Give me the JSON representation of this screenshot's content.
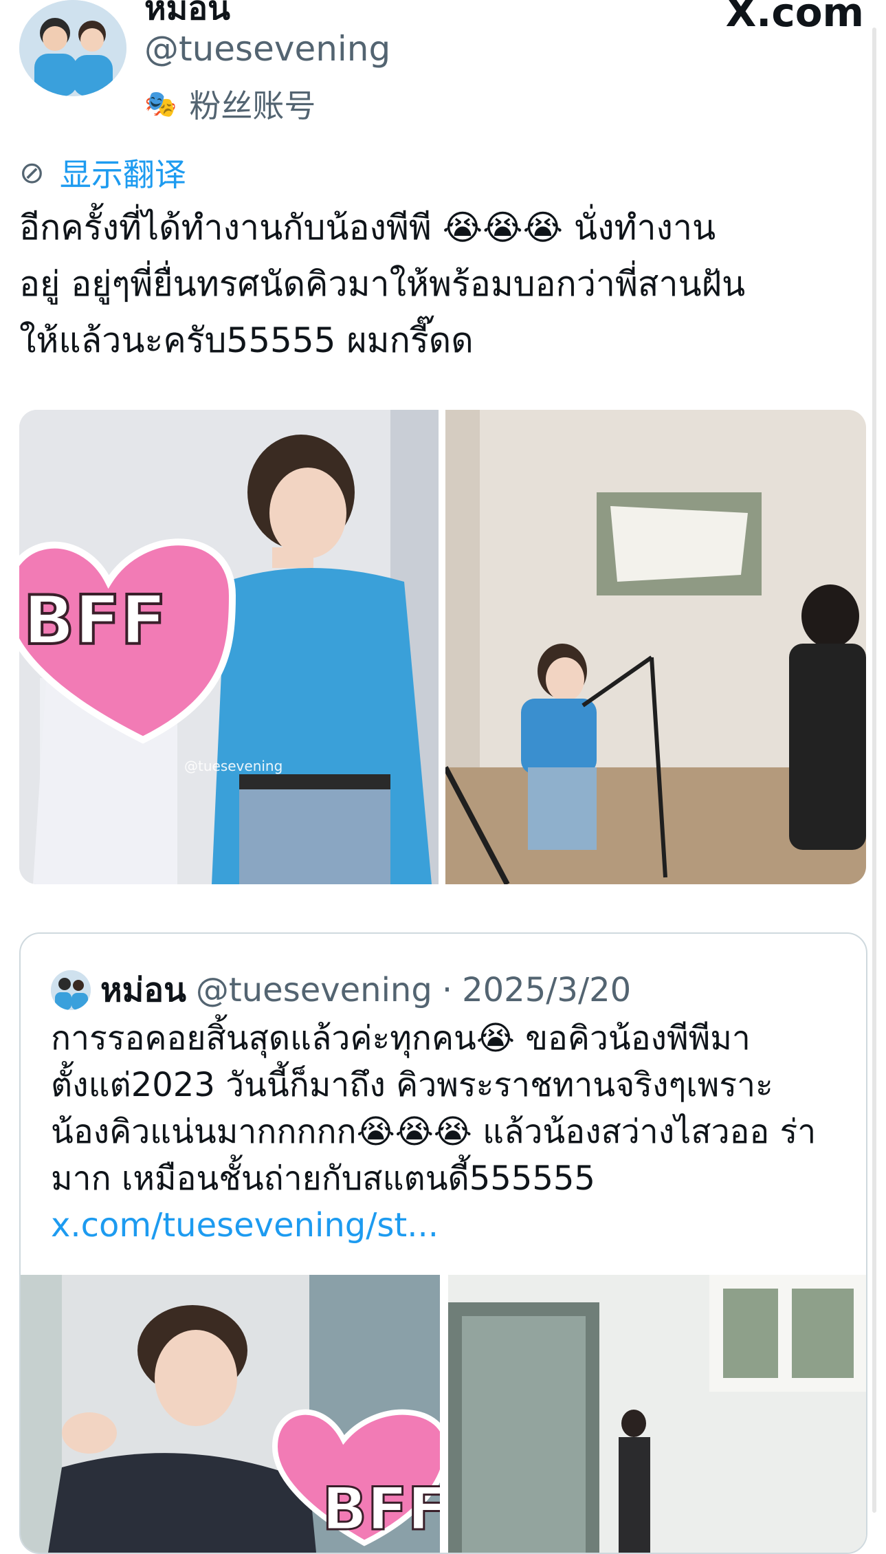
{
  "profile": {
    "name": "หม่อน",
    "handle": "@tuesevening",
    "fan_label": "粉丝账号",
    "fan_icon": "theater-mask-icon"
  },
  "site": "X.com",
  "translate_label": "显示翻译",
  "tweet_text": "อีกครั้งที่ได้ทำงานกับน้องพีพี 😭😭😭 นั่งทำงาน\nอยู่ อยู่ๆพี่ยื่นทรศนัดคิวมาให้พร้อมบอกว่าพี่สานฝัน\nให้แล้วนะครับ55555 ผมกรี๊ดด",
  "images": {
    "left_sticker": "BFF",
    "left_watermark": "@tuesevening"
  },
  "quote": {
    "name": "หม่อน",
    "handle": "@tuesevening",
    "separator": "·",
    "date": "2025/3/20",
    "text": "การรอคอยสิ้นสุดแล้วค่ะทุกคน😭 ขอคิวน้องพีพีมา ตั้งแต่2023 วันนี้ก็มาถึง คิวพระราชทานจริงๆเพราะ น้องคิวแน่นมากกกกก😭😭😭 แล้วน้องสว่างไสวออ ร่ามาก เหมือนชั้นถ่ายกับสแตนดี้555555 ",
    "link": "x.com/tuesevening/st...",
    "sticker": "BFF"
  },
  "colors": {
    "accent": "#1d9bf0",
    "secondary_text": "#536471",
    "border": "#cfd9de",
    "sticker_pink": "#f27bb5"
  }
}
